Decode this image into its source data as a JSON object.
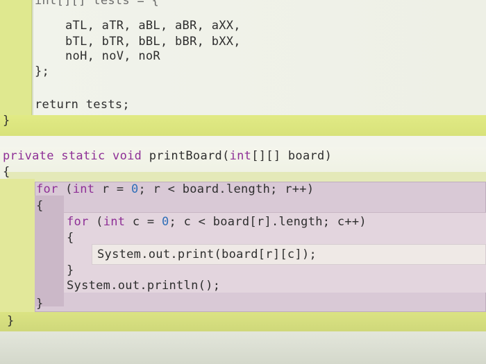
{
  "code": {
    "array_header": "int[][] tests = {",
    "row1": "aTL, aTR, aBL, aBR, aXX,",
    "row2": "bTL, bTR, bBL, bBR, bXX,",
    "row3": "noH, noV, noR",
    "array_close": "};",
    "return_stmt": "return tests;",
    "method_close_1": "}",
    "pb_sig_private": "private ",
    "pb_sig_static": "static ",
    "pb_sig_void": "void ",
    "pb_sig_name": "printBoard(",
    "pb_sig_int": "int",
    "pb_sig_rest": "[][] board)",
    "pb_open": "{",
    "for1_for": "for",
    "for1_paren": " (",
    "for1_int": "int",
    "for1_mid": " r = ",
    "for1_zero": "0",
    "for1_rest": "; r < board.length; r++)",
    "for1_open": "{",
    "for2_for": "for",
    "for2_paren": " (",
    "for2_int": "int",
    "for2_mid": " c = ",
    "for2_zero": "0",
    "for2_rest": "; c < board[r].length; c++)",
    "for2_open": "{",
    "print_stmt": "System.out.print(board[r][c]);",
    "for2_close": "}",
    "println_stmt": "System.out.println();",
    "for1_close": "}",
    "method_close_2": "}"
  },
  "colors": {
    "keyword": "#8e2f96",
    "number": "#2f6fb8",
    "scope_method": "#e4e9b8",
    "scope_loop": "#d9c9d6"
  }
}
